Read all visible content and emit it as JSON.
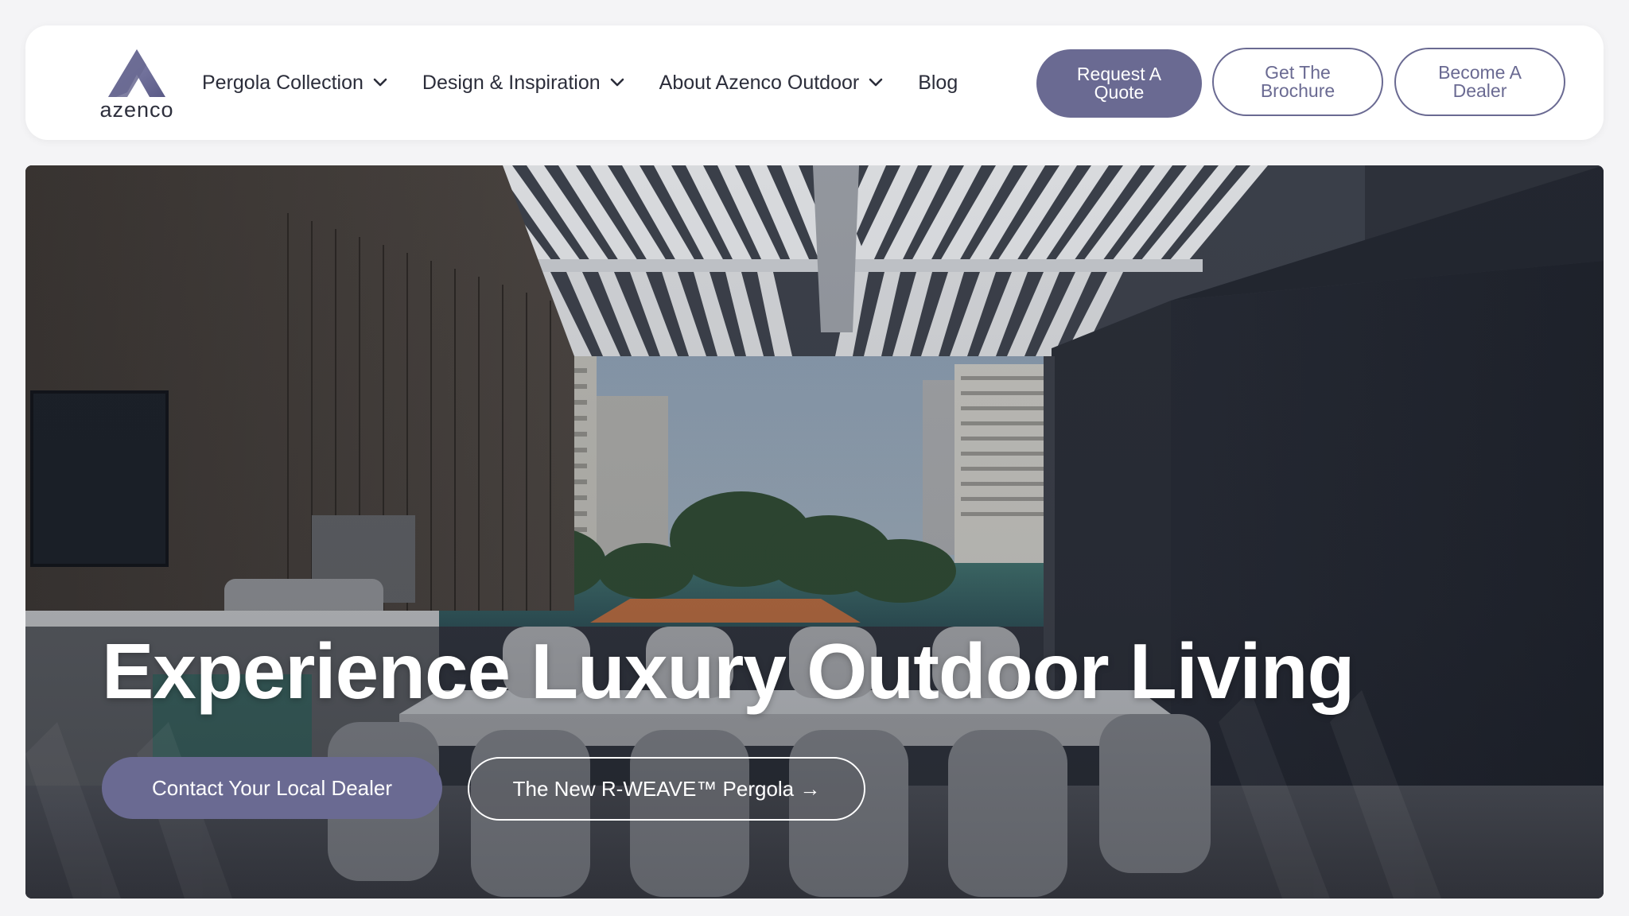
{
  "brand": {
    "name": "azenco",
    "accent": "#6a6a92"
  },
  "nav": {
    "items": [
      {
        "label": "Pergola Collection",
        "has_dropdown": true
      },
      {
        "label": "Design & Inspiration",
        "has_dropdown": true
      },
      {
        "label": "About Azenco Outdoor",
        "has_dropdown": true
      },
      {
        "label": "Blog",
        "has_dropdown": false
      }
    ],
    "dropdown_icon": "chevron-down-icon"
  },
  "header_buttons": {
    "quote": [
      "Request A",
      "Quote"
    ],
    "brochure": [
      "Get The",
      "Brochure"
    ],
    "dealer": [
      "Become A",
      "Dealer"
    ]
  },
  "hero": {
    "title": "Experience Luxury Outdoor Living",
    "primary_cta": "Contact Your Local Dealer",
    "secondary_cta": "The New R-WEAVE™ Pergola →",
    "image": "outdoor-kitchen-under-louvered-pergola-with-city-view"
  }
}
